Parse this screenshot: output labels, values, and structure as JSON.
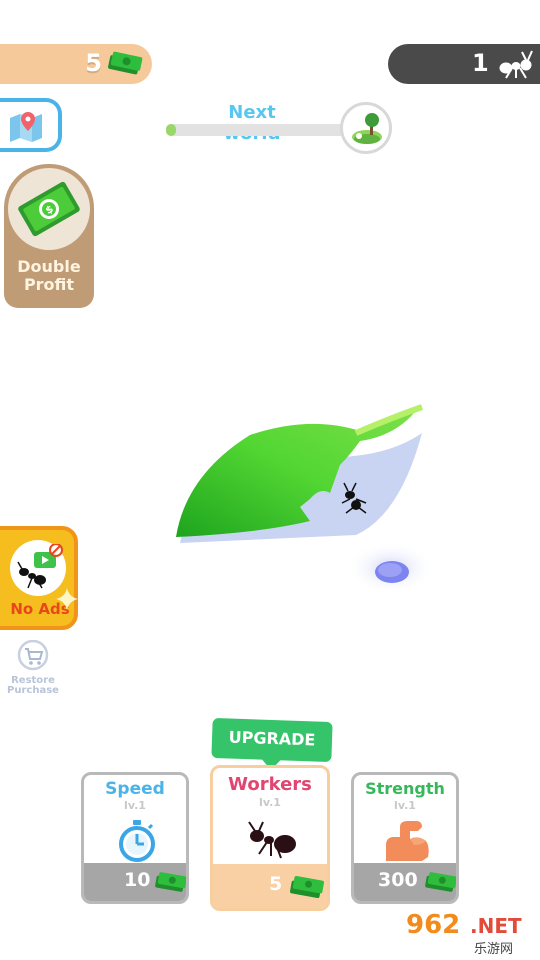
{
  "hud": {
    "money": "5",
    "ant_count": "1",
    "next_world_label": "Next world",
    "next_world_progress": 0.05
  },
  "buttons": {
    "double_profit_line1": "Double",
    "double_profit_line2": "Profit",
    "no_ads": "No Ads",
    "restore_line1": "Restore",
    "restore_line2": "Purchase"
  },
  "upgrade_tag": "UPGRADE",
  "cards": [
    {
      "title": "Speed",
      "level": "lv.1",
      "price": "10",
      "title_color": "#4ab4e8",
      "icon": "stopwatch-icon"
    },
    {
      "title": "Workers",
      "level": "lv.1",
      "price": "5",
      "title_color": "#e0466f",
      "icon": "ant-icon"
    },
    {
      "title": "Strength",
      "level": "lv.1",
      "price": "300",
      "title_color": "#36b85a",
      "icon": "muscle-arm-icon"
    }
  ],
  "watermark": {
    "num": "962",
    "net": ".NET",
    "cn": "乐游网"
  },
  "colors": {
    "money_pill": "#f6c99a",
    "ant_pill": "#4a4a4a",
    "leaf": "#52d633",
    "upgrade_green": "#36c46b",
    "no_ads_yellow": "#f6bd1e"
  }
}
